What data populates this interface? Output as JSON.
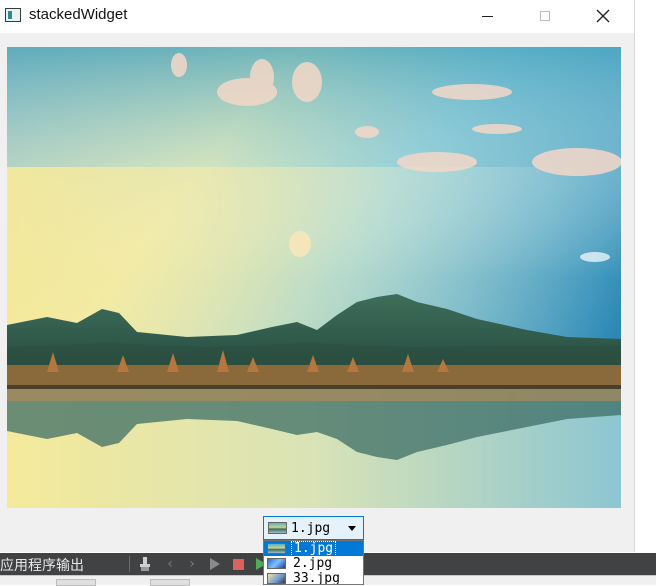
{
  "window": {
    "title": "stackedWidget"
  },
  "combo": {
    "selected_label": "1.jpg",
    "selected_icon": "landscape-thumbnail-icon",
    "options": [
      {
        "label": "1.jpg",
        "icon": "landscape-thumbnail-icon"
      },
      {
        "label": "2.jpg",
        "icon": "blue-abstract-thumbnail-icon"
      },
      {
        "label": "33.jpg",
        "icon": "sky-thumbnail-icon"
      }
    ]
  },
  "output_panel": {
    "title": "应用程序输出",
    "tools": [
      "clear-output-icon",
      "prev-arrow-icon",
      "next-arrow-icon",
      "run-icon",
      "stop-icon",
      "debug-run-icon"
    ]
  },
  "colors": {
    "accent": "#0078d7",
    "panel_dark": "#404244",
    "stop": "#e06060",
    "debug": "#4caf50"
  }
}
